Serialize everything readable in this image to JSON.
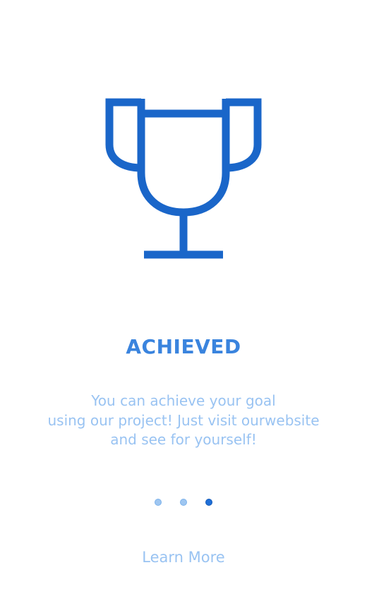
{
  "onboarding": {
    "icon": "trophy-icon",
    "title": "ACHIEVED",
    "description_lines": [
      "You can achieve your goal",
      "using our project! Just visit ourwebsite",
      "and see for yourself!"
    ],
    "page_indicator": {
      "total": 3,
      "current": 3
    },
    "learn_more_label": "Learn More"
  },
  "colors": {
    "icon": "#1a66c9",
    "title": "#3a84de",
    "text": "#99c3f2",
    "dot_inactive": "#9ec6f1",
    "dot_active": "#1f6fd8"
  }
}
